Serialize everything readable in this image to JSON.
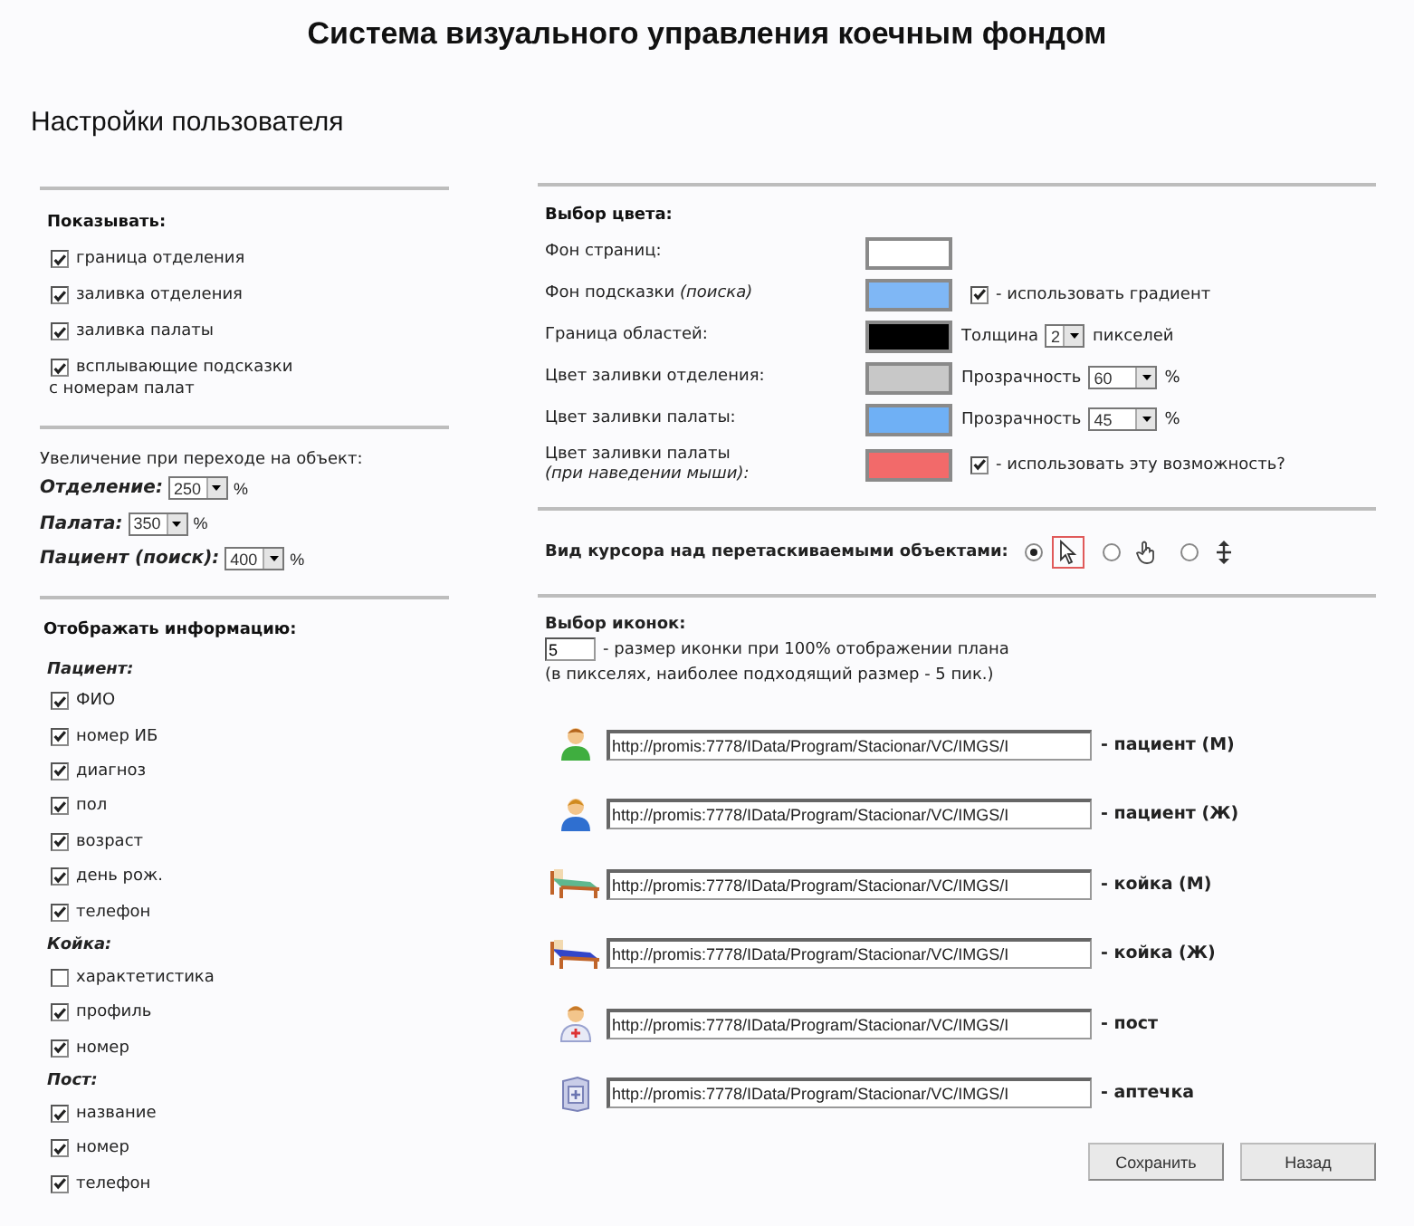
{
  "title": "Система визуального управления коечным фондом",
  "subtitle": "Настройки пользователя",
  "show": {
    "heading": "Показывать:",
    "items": [
      {
        "label": "граница отделения",
        "checked": true
      },
      {
        "label": "заливка отделения",
        "checked": true
      },
      {
        "label": "заливка палаты",
        "checked": true
      },
      {
        "label": "всплывающие подсказки",
        "checked": true,
        "note": "с номерам палат"
      }
    ]
  },
  "zoom": {
    "heading": "Увеличение при переходе на объект:",
    "rows": [
      {
        "label": "Отделение:",
        "value": "250",
        "unit": "%"
      },
      {
        "label": "Палата:",
        "value": "350",
        "unit": "%"
      },
      {
        "label": "Пациент (поиск):",
        "value": "400",
        "unit": "%"
      }
    ]
  },
  "info": {
    "heading": "Отображать информацию:",
    "groups": [
      {
        "title": "Пациент:",
        "items": [
          {
            "label": "ФИО",
            "checked": true
          },
          {
            "label": "номер ИБ",
            "checked": true
          },
          {
            "label": "диагноз",
            "checked": true
          },
          {
            "label": "пол",
            "checked": true
          },
          {
            "label": "возраст",
            "checked": true
          },
          {
            "label": "день рож.",
            "checked": true
          },
          {
            "label": "телефон",
            "checked": true
          }
        ]
      },
      {
        "title": "Койка:",
        "items": [
          {
            "label": "характетистика",
            "checked": false
          },
          {
            "label": "профиль",
            "checked": true
          },
          {
            "label": "номер",
            "checked": true
          }
        ]
      },
      {
        "title": "Пост:",
        "items": [
          {
            "label": "название",
            "checked": true
          },
          {
            "label": "номер",
            "checked": true
          },
          {
            "label": "телефон",
            "checked": true
          }
        ]
      }
    ]
  },
  "colors": {
    "heading": "Выбор цвета:",
    "rows": [
      {
        "label": "Фон страниц:",
        "color": "#ffffff",
        "kind": "plain"
      },
      {
        "label": "Фон подсказки *(поиска)*",
        "color": "#7fb7f5",
        "kind": "checkbox",
        "checked": true,
        "text": "- использовать градиент"
      },
      {
        "label": "Граница областей:",
        "color": "#000000",
        "kind": "select",
        "prefix": "Толщина",
        "value": "2",
        "suffix": "пикселей"
      },
      {
        "label": "Цвет заливки отделения:",
        "color": "#c8c8c8",
        "kind": "select",
        "prefix": "Прозрачность",
        "value": "60",
        "suffix": "%"
      },
      {
        "label": "Цвет заливки палаты:",
        "color": "#6fb0f5",
        "kind": "select",
        "prefix": "Прозрачность",
        "value": "45",
        "suffix": "%"
      },
      {
        "label": "Цвет заливки палаты",
        "sublabel": "(при наведении мыши):",
        "color": "#f26a6a",
        "kind": "checkbox",
        "checked": true,
        "text": "- использовать эту возможность?"
      }
    ]
  },
  "cursor": {
    "label": "Вид курсора над перетаскиваемыми объектами:",
    "options": [
      {
        "kind": "arrow",
        "selected": true
      },
      {
        "kind": "hand",
        "selected": false
      },
      {
        "kind": "move",
        "selected": false
      }
    ]
  },
  "icons": {
    "heading": "Выбор иконок:",
    "size": "5",
    "size_note": "- размер иконки при 100% отображении плана",
    "size_hint": "(в пикселях, наиболее подходящий размер - 5 пик.)",
    "items": [
      {
        "kind": "person-green",
        "url": "http://promis:7778/IData/Program/Stacionar/VC/IMGS/I",
        "label": "- пациент (М)"
      },
      {
        "kind": "person-blue",
        "url": "http://promis:7778/IData/Program/Stacionar/VC/IMGS/I",
        "label": "- пациент (Ж)"
      },
      {
        "kind": "bed-green",
        "url": "http://promis:7778/IData/Program/Stacionar/VC/IMGS/I",
        "label": "- койка (М)"
      },
      {
        "kind": "bed-blue",
        "url": "http://promis:7778/IData/Program/Stacionar/VC/IMGS/I",
        "label": "- койка (Ж)"
      },
      {
        "kind": "nurse",
        "url": "http://promis:7778/IData/Program/Stacionar/VC/IMGS/I",
        "label": "- пост"
      },
      {
        "kind": "cabinet",
        "url": "http://promis:7778/IData/Program/Stacionar/VC/IMGS/I",
        "label": "- аптечка"
      }
    ]
  },
  "buttons": [
    "Сохранить",
    "Назад"
  ]
}
